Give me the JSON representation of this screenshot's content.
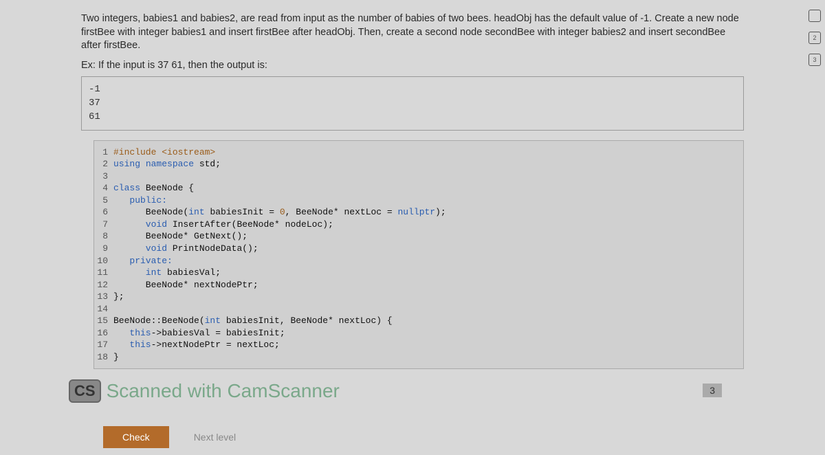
{
  "instructions": "Two integers, babies1 and babies2, are read from input as the number of babies of two bees. headObj has the default value of -1. Create a new node firstBee with integer babies1 and insert firstBee after headObj. Then, create a second node secondBee with integer babies2 and insert secondBee after firstBee.",
  "example_label": "Ex: If the input is 37  61, then the output is:",
  "output_lines": [
    "-1",
    "37",
    "61"
  ],
  "code": {
    "lines": [
      {
        "n": "1",
        "tokens": [
          {
            "t": "#include <iostream>",
            "c": "kw-preproc"
          }
        ]
      },
      {
        "n": "2",
        "tokens": [
          {
            "t": "using ",
            "c": "kw-blue"
          },
          {
            "t": "namespace ",
            "c": "kw-blue"
          },
          {
            "t": "std;",
            "c": ""
          }
        ]
      },
      {
        "n": "3",
        "tokens": []
      },
      {
        "n": "4",
        "tokens": [
          {
            "t": "class ",
            "c": "kw-blue"
          },
          {
            "t": "BeeNode {",
            "c": ""
          }
        ]
      },
      {
        "n": "5",
        "tokens": [
          {
            "t": "   public:",
            "c": "kw-blue"
          }
        ]
      },
      {
        "n": "6",
        "tokens": [
          {
            "t": "      BeeNode(",
            "c": ""
          },
          {
            "t": "int ",
            "c": "kw-blue"
          },
          {
            "t": "babiesInit = ",
            "c": ""
          },
          {
            "t": "0",
            "c": "kw-num"
          },
          {
            "t": ", BeeNode* nextLoc = ",
            "c": ""
          },
          {
            "t": "nullptr",
            "c": "kw-blue"
          },
          {
            "t": ");",
            "c": ""
          }
        ]
      },
      {
        "n": "7",
        "tokens": [
          {
            "t": "      void ",
            "c": "kw-blue"
          },
          {
            "t": "InsertAfter(BeeNode* nodeLoc);",
            "c": ""
          }
        ]
      },
      {
        "n": "8",
        "tokens": [
          {
            "t": "      BeeNode* GetNext();",
            "c": ""
          }
        ]
      },
      {
        "n": "9",
        "tokens": [
          {
            "t": "      void ",
            "c": "kw-blue"
          },
          {
            "t": "PrintNodeData();",
            "c": ""
          }
        ]
      },
      {
        "n": "10",
        "tokens": [
          {
            "t": "   private:",
            "c": "kw-blue"
          }
        ]
      },
      {
        "n": "11",
        "tokens": [
          {
            "t": "      int ",
            "c": "kw-blue"
          },
          {
            "t": "babiesVal;",
            "c": ""
          }
        ]
      },
      {
        "n": "12",
        "tokens": [
          {
            "t": "      BeeNode* nextNodePtr;",
            "c": ""
          }
        ]
      },
      {
        "n": "13",
        "tokens": [
          {
            "t": "};",
            "c": ""
          }
        ]
      },
      {
        "n": "14",
        "tokens": []
      },
      {
        "n": "15",
        "tokens": [
          {
            "t": "BeeNode::BeeNode(",
            "c": ""
          },
          {
            "t": "int ",
            "c": "kw-blue"
          },
          {
            "t": "babiesInit, BeeNode* nextLoc) {",
            "c": ""
          }
        ]
      },
      {
        "n": "16",
        "tokens": [
          {
            "t": "   this",
            "c": "kw-blue"
          },
          {
            "t": "->babiesVal = babiesInit;",
            "c": ""
          }
        ]
      },
      {
        "n": "17",
        "tokens": [
          {
            "t": "   this",
            "c": "kw-blue"
          },
          {
            "t": "->nextNodePtr = nextLoc;",
            "c": ""
          }
        ]
      },
      {
        "n": "18",
        "tokens": [
          {
            "t": "}",
            "c": ""
          }
        ]
      }
    ]
  },
  "watermark": {
    "badge": "CS",
    "text_prefix": "Scanned with ",
    "text_brand": "CamScanner"
  },
  "page_number": "3",
  "buttons": {
    "check": "Check",
    "next": "Next level"
  },
  "sidebar": {
    "box2": "2",
    "box3": "3"
  }
}
